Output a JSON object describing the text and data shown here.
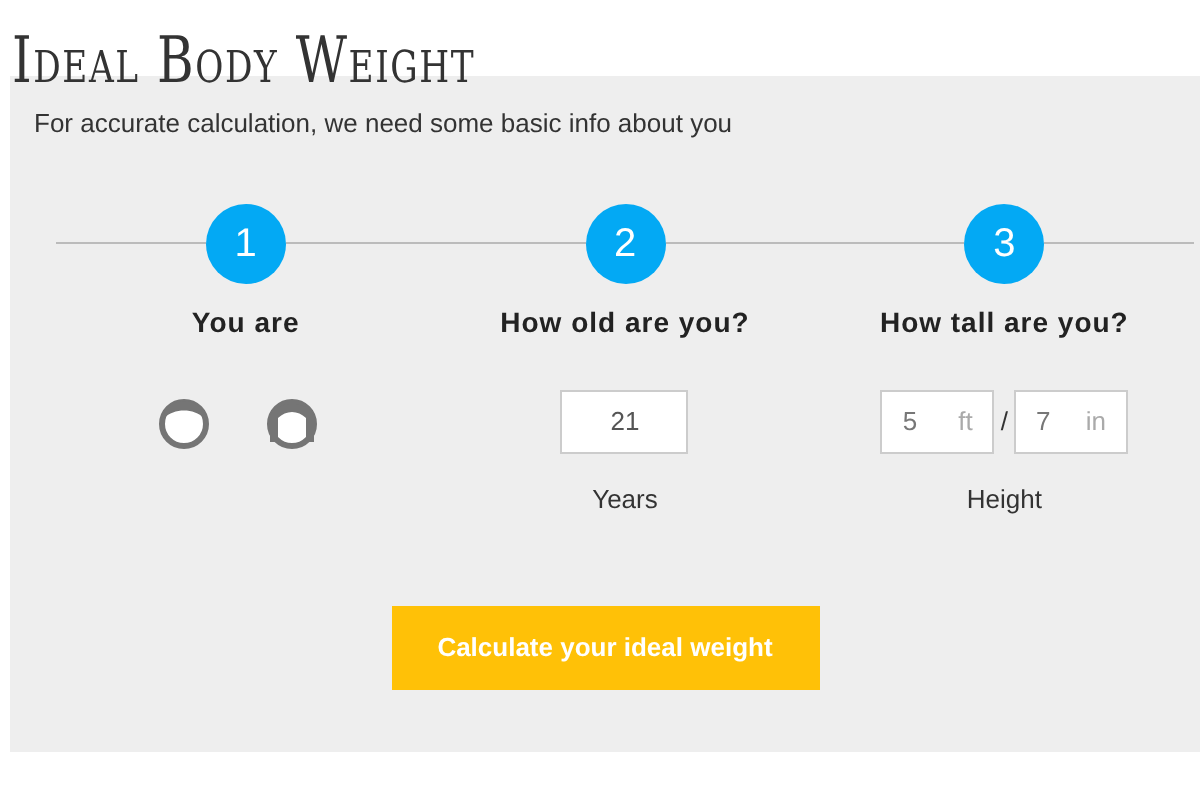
{
  "title": "Ideal Body Weight",
  "intro": "For accurate calculation, we need some basic info about you",
  "steps": [
    {
      "number": "1",
      "label": "You are",
      "kind": "gender"
    },
    {
      "number": "2",
      "label": "How old are you?",
      "kind": "age",
      "value": "21",
      "caption": "Years"
    },
    {
      "number": "3",
      "label": "How tall are you?",
      "kind": "height",
      "feet": "5",
      "feet_unit": "ft",
      "separator": "/",
      "inches": "7",
      "inches_unit": "in",
      "caption": "Height"
    }
  ],
  "button": "Calculate your ideal weight"
}
